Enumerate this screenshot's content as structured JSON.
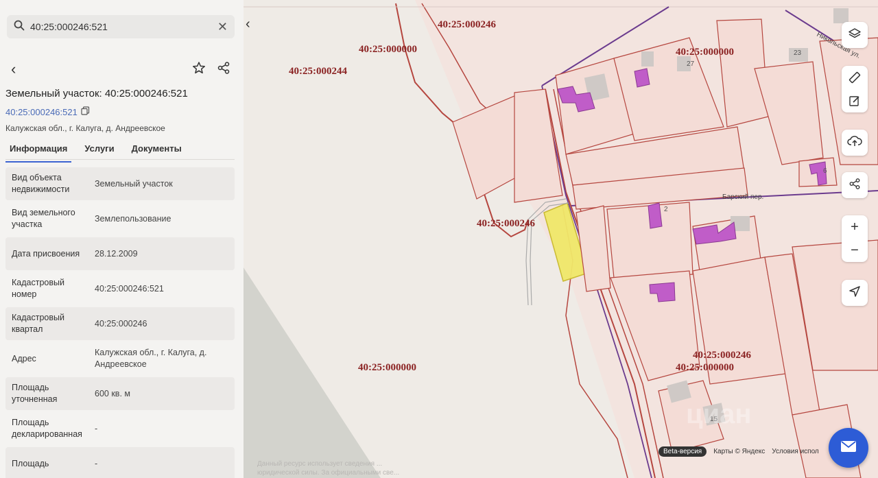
{
  "search": {
    "value": "40:25:000246:521"
  },
  "card": {
    "title": "Земельный участок: 40:25:000246:521",
    "cadastral_link": "40:25:000246:521",
    "address_short": "Калужская обл., г. Калуга, д. Андреевское"
  },
  "tabs": [
    {
      "label": "Информация",
      "active": true
    },
    {
      "label": "Услуги",
      "active": false
    },
    {
      "label": "Документы",
      "active": false
    }
  ],
  "rows": [
    {
      "label": "Вид объекта недвижимости",
      "value": "Земельный участок"
    },
    {
      "label": "Вид земельного участка",
      "value": "Землепользование"
    },
    {
      "label": "Дата присвоения",
      "value": "28.12.2009"
    },
    {
      "label": "Кадастровый номер",
      "value": "40:25:000246:521"
    },
    {
      "label": "Кадастровый квартал",
      "value": "40:25:000246"
    },
    {
      "label": "Адрес",
      "value": "Калужская обл., г. Калуга, д. Андреевское"
    },
    {
      "label": "Площадь уточненная",
      "value": "600 кв. м"
    },
    {
      "label": "Площадь декларированная",
      "value": "-"
    },
    {
      "label": "Площадь",
      "value": "-"
    }
  ],
  "map": {
    "quarter_labels": [
      "40:25:000246",
      "40:25:000000",
      "40:25:000244",
      "40:25:000000",
      "40:25:000246",
      "40:25:000000",
      "40:25:000246",
      "40:25:000000"
    ],
    "street_nikolskaya": "Никольская ул.",
    "street_barsky": "Барский пер.",
    "house_23": "23",
    "house_27": "27",
    "house_2": "2",
    "house_6": "6",
    "house_15": "15",
    "watermark": "циан",
    "disclaimer": "Данный ресурс использует сведения ... юридической силы. За официальными све..."
  },
  "bottom": {
    "beta": "Beta-версия",
    "maps": "Карты © Яндекс",
    "terms": "Условия испол"
  },
  "colors": {
    "accent": "#3b63d1",
    "boundary": "#b5463f",
    "quarter_label": "#8b2323",
    "selected_parcel": "#f0e86a",
    "building": "#c05dc8",
    "street_line": "#6b3b8e",
    "mail_button": "#2d5cd6"
  },
  "icons": {
    "search": "search-icon",
    "clear": "close-icon",
    "back": "chevron-left-icon",
    "favorite": "star-icon",
    "share": "share-icon",
    "copy": "copy-icon",
    "layers": "layers-icon",
    "ruler": "ruler-icon",
    "edit": "edit-icon",
    "upload": "cloud-upload-icon",
    "map_share": "share-icon",
    "zoom_in": "plus-icon",
    "zoom_out": "minus-icon",
    "locate": "navigation-arrow-icon",
    "mail": "mail-icon"
  }
}
